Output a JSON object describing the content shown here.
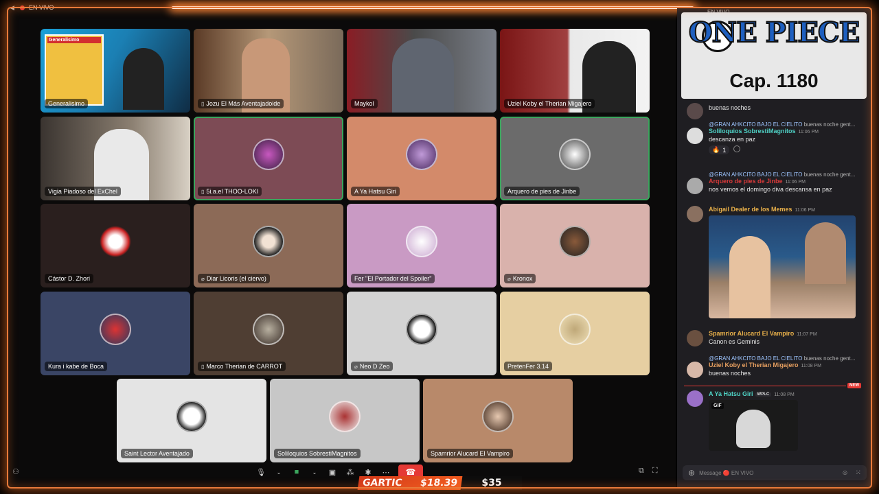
{
  "stage": {
    "live_label": "EN VIVO"
  },
  "tiles": [
    {
      "name": "Generalisimo",
      "mic": "",
      "cam_label": "Generalisimo"
    },
    {
      "name": "Jozu El Más Aventajadoide",
      "mic": "▯"
    },
    {
      "name": "Maykol",
      "mic": ""
    },
    {
      "name": "Uziel Koby el Therian Migajero",
      "mic": ""
    },
    {
      "name": "Vigia Piadoso del ExChel",
      "mic": ""
    },
    {
      "name": "5i.a.el THOO-LOKI",
      "mic": "▯"
    },
    {
      "name": "A Ya Hatsu Giri",
      "mic": ""
    },
    {
      "name": "Arquero de pies de Jinbe",
      "mic": ""
    },
    {
      "name": "Cástor D. Zhori",
      "mic": ""
    },
    {
      "name": "Diar Licoris (el ciervo)",
      "mic": "⌀"
    },
    {
      "name": "Fer \"El Portador del Spoiler\"",
      "mic": ""
    },
    {
      "name": "Kronox",
      "mic": "⌀"
    },
    {
      "name": "Kura i kabe de Boca",
      "mic": ""
    },
    {
      "name": "Marco Therian de CARROT",
      "mic": "▯"
    },
    {
      "name": "Neo D Zeo",
      "mic": "⌀"
    },
    {
      "name": "PretenFer 3.14",
      "mic": ""
    },
    {
      "name": "Saint Lector Aventajado",
      "mic": ""
    },
    {
      "name": "Soliloquios SobrestiMagnitos",
      "mic": ""
    },
    {
      "name": "Spamrior Alucard El Vampiro",
      "mic": ""
    }
  ],
  "gartic": {
    "label": "GARTIC",
    "amount_left": "$18.39",
    "amount_right": "$35"
  },
  "overlay": {
    "logo_text": "ONE PIECE",
    "chapter": "Cap. 1180",
    "live_label": "EN VIVO"
  },
  "chat": {
    "messages": [
      {
        "text": "buenas noches"
      },
      {
        "reply": "@GRAN AHKCITO BAJO EL CIELITO",
        "reply_text": "buenas noche gent...",
        "author": "Soliloquios SobrestiMagnitos",
        "time": "11:06 PM",
        "text": "descanza en paz",
        "reaction_emoji": "🔥",
        "reaction_count": "1"
      },
      {
        "reply": "@GRAN AHKCITO BAJO EL CIELITO",
        "reply_text": "buenas noche gent...",
        "author": "Arquero de pies de Jinbe",
        "time": "11:06 PM",
        "text": "nos vemos el domingo diva descansa en paz"
      },
      {
        "author": "Abigail Dealer de los Memes",
        "time": "11:06 PM"
      },
      {
        "author": "Spamrior Alucard El Vampiro",
        "time": "11:07 PM",
        "text": "Canon es Geminis"
      },
      {
        "reply": "@GRAN AHKCITO BAJO EL CIELITO",
        "reply_text": "buenas noche gent...",
        "author": "Uziel Koby el Therian Migajero",
        "time": "11:08 PM",
        "text": "buenas noches"
      },
      {
        "author": "A Ya Hatsu Giri",
        "tag": "WPLC",
        "time": "11:08 PM",
        "gif_label": "GIF"
      }
    ],
    "new_label": "NEW",
    "input_placeholder": "Message 🔴 EN VIVO"
  },
  "colors": {
    "frame": "#e87a3a",
    "speaking": "#3ba55d",
    "end_call": "#e53935"
  }
}
